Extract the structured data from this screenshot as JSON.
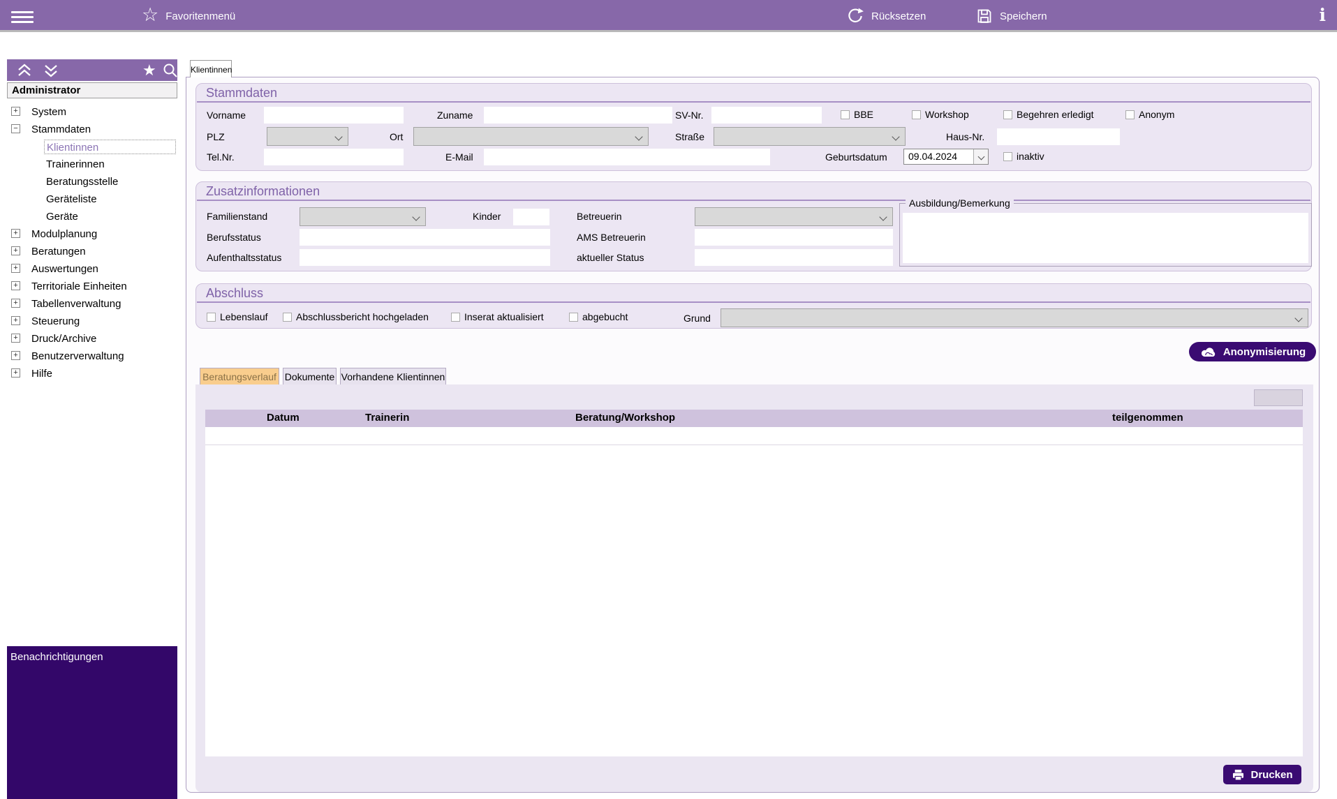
{
  "topbar": {
    "favorites_label": "Favoritenmenü",
    "reset_label": "Rücksetzen",
    "save_label": "Speichern"
  },
  "sidebar": {
    "user": "Administrator",
    "tree": [
      {
        "label": "System",
        "expander": "+",
        "level": 0
      },
      {
        "label": "Stammdaten",
        "expander": "−",
        "level": 0
      },
      {
        "label": "Klientinnen",
        "expander": "",
        "level": 1,
        "selected": true
      },
      {
        "label": "Trainerinnen",
        "expander": "",
        "level": 1
      },
      {
        "label": "Beratungsstelle",
        "expander": "",
        "level": 1
      },
      {
        "label": "Geräteliste",
        "expander": "",
        "level": 1
      },
      {
        "label": "Geräte",
        "expander": "",
        "level": 1
      },
      {
        "label": "Modulplanung",
        "expander": "+",
        "level": 0
      },
      {
        "label": "Beratungen",
        "expander": "+",
        "level": 0
      },
      {
        "label": "Auswertungen",
        "expander": "+",
        "level": 0
      },
      {
        "label": "Territoriale Einheiten",
        "expander": "+",
        "level": 0
      },
      {
        "label": "Tabellenverwaltung",
        "expander": "+",
        "level": 0
      },
      {
        "label": "Steuerung",
        "expander": "+",
        "level": 0
      },
      {
        "label": "Druck/Archive",
        "expander": "+",
        "level": 0
      },
      {
        "label": "Benutzerverwaltung",
        "expander": "+",
        "level": 0
      },
      {
        "label": "Hilfe",
        "expander": "+",
        "level": 0
      }
    ],
    "notifications_label": "Benachrichtigungen"
  },
  "main": {
    "tab_label": "Klientinnen",
    "stammdaten": {
      "title": "Stammdaten",
      "vorname": "Vorname",
      "zuname": "Zuname",
      "svnr": "SV-Nr.",
      "bbe": "BBE",
      "workshop": "Workshop",
      "begehren": "Begehren erledigt",
      "anonym": "Anonym",
      "plz": "PLZ",
      "ort": "Ort",
      "strasse": "Straße",
      "hausnr": "Haus-Nr.",
      "telnr": "Tel.Nr.",
      "email": "E-Mail",
      "geburtsdatum": "Geburtsdatum",
      "geburtsdatum_value": "09.04.2024",
      "inaktiv": "inaktiv"
    },
    "zusatz": {
      "title": "Zusatzinformationen",
      "familienstand": "Familienstand",
      "kinder": "Kinder",
      "betreuerin": "Betreuerin",
      "berufsstatus": "Berufsstatus",
      "ams": "AMS Betreuerin",
      "aufenthalt": "Aufenthaltsstatus",
      "aktueller_status": "aktueller Status",
      "ausbildung": "Ausbildung/Bemerkung"
    },
    "abschluss": {
      "title": "Abschluss",
      "lebenslauf": "Lebenslauf",
      "abschlussbericht": "Abschlussbericht hochgeladen",
      "inserat": "Inserat aktualisiert",
      "abgebucht": "abgebucht",
      "grund": "Grund"
    },
    "anonymisierung_label": "Anonymisierung",
    "tabs": [
      {
        "label": "Beratungsverlauf",
        "active": true
      },
      {
        "label": "Dokumente",
        "active": false
      },
      {
        "label": "Vorhandene Klientinnen",
        "active": false
      }
    ],
    "table": {
      "columns": [
        "Datum",
        "Trainerin",
        "Beratung/Workshop",
        "teilgenommen"
      ]
    },
    "drucken_label": "Drucken"
  },
  "colors": {
    "toolbar_purple": "#8768A9",
    "accent_dark": "#3A0B72",
    "notifications_panel": "#330769",
    "groupbox_lavender": "#ECE6F3",
    "table_header": "#CFC2DD",
    "active_tab_orange": "#F9CD8D"
  }
}
